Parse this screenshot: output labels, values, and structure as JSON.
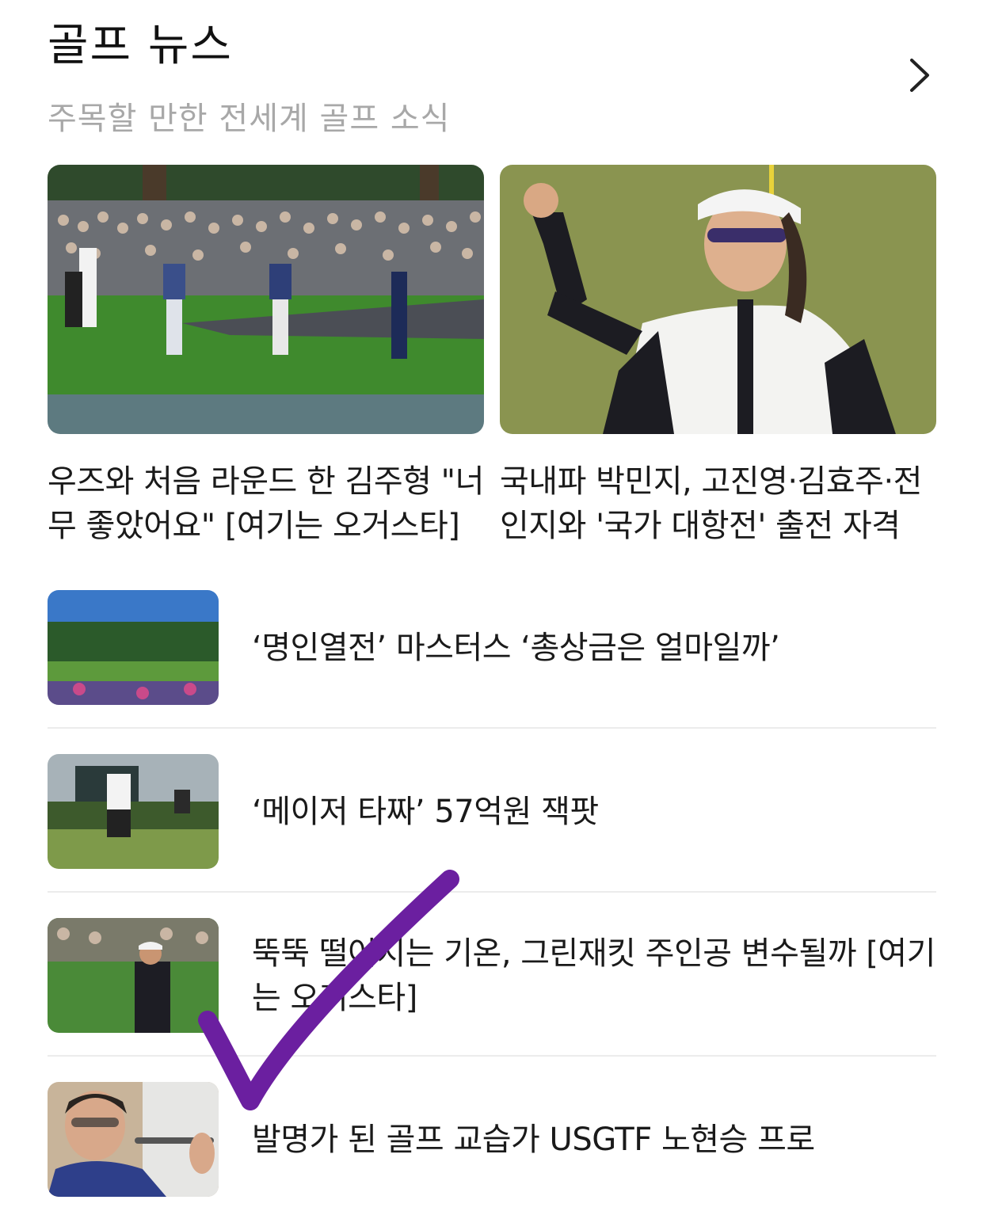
{
  "section": {
    "title": "골프 뉴스",
    "subtitle": "주목할 만한 전세계 골프 소식"
  },
  "icons": {
    "more": "chevron-right-icon"
  },
  "cards": [
    {
      "caption": "우즈와 처음 라운드 한 김주형 \"너무 좋았어요\" [여기는 오거스타]"
    },
    {
      "caption": "국내파 박민지, 고진영·김효주·전인지와 '국가 대항전' 출전 자격"
    }
  ],
  "list": [
    {
      "title": "‘명인열전’ 마스터스 ‘총상금은 얼마일까’"
    },
    {
      "title": "‘메이저 타짜’ 57억원 잭팟"
    },
    {
      "title": "뚝뚝 떨어지는 기온, 그린재킷 주인공 변수될까 [여기는 오거스타]"
    },
    {
      "title": "발명가 된 골프 교습가 USGTF 노현승 프로"
    }
  ],
  "annotation": {
    "color": "#6b1fa0"
  }
}
